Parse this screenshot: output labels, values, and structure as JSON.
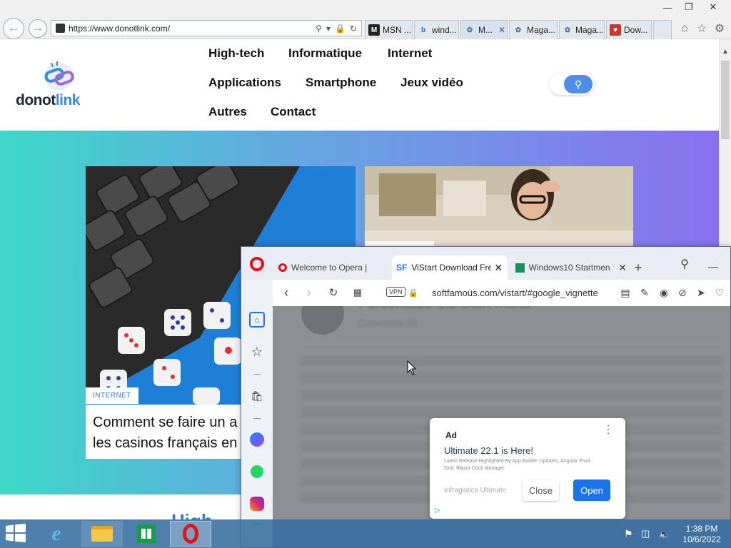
{
  "ie": {
    "address": "https://www.donotlink.com/",
    "tabs": [
      {
        "label": "MSN ...",
        "icon": "msn-icon"
      },
      {
        "label": "wind...",
        "icon": "bing-icon"
      },
      {
        "label": "M...",
        "icon": "site-icon"
      },
      {
        "label": "Maga...",
        "icon": "site-icon"
      },
      {
        "label": "Maga...",
        "icon": "site-icon"
      },
      {
        "label": "Dow...",
        "icon": "shield-icon"
      }
    ]
  },
  "site": {
    "logo_part1": "donot",
    "logo_part2": "link",
    "menu": [
      "High-tech",
      "Informatique",
      "Internet",
      "Applications",
      "Smartphone",
      "Jeux vidéo",
      "Autres",
      "Contact"
    ],
    "article": {
      "category": "INTERNET",
      "title_line1": "Comment se faire un a",
      "title_line2": "les casinos français en"
    },
    "below_text": "High"
  },
  "opera": {
    "tabs": [
      {
        "label": "Welcome to Opera |",
        "icon": "opera-icon"
      },
      {
        "label": "ViStart Download Fre",
        "icon": "sf-icon"
      },
      {
        "label": "Windows10 Startmen",
        "icon": "app-icon"
      }
    ],
    "vpn": "VPN",
    "url": "softfamous.com/vistart/#google_vignette",
    "blurred_title": "Personalize the Start menu",
    "blurred_sub": "Comments (0)"
  },
  "ad": {
    "label": "Ad",
    "headline": "Ultimate 22.1 is Here!",
    "body": "Latest Release Highlighted By App Builder Updates, Angular Pivot Grid, Blazor Dock Manager",
    "advertiser": "Infragistics Ultimate",
    "close": "Close",
    "open": "Open"
  },
  "taskbar": {
    "time": "1:38 PM",
    "date": "10/6/2022"
  },
  "colors": {
    "accent_blue": "#1a73e8",
    "opera_red": "#e0121a",
    "hero_start": "#3ed8c9",
    "hero_end": "#8a70f0"
  }
}
